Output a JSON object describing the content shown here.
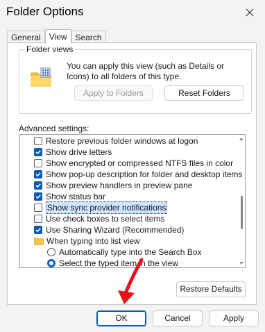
{
  "window": {
    "title": "Folder Options"
  },
  "tabs": [
    {
      "label": "General"
    },
    {
      "label": "View"
    },
    {
      "label": "Search"
    }
  ],
  "folder_views": {
    "title": "Folder views",
    "description": "You can apply this view (such as Details or Icons) to all folders of this type.",
    "apply_button": "Apply to Folders",
    "reset_button": "Reset Folders"
  },
  "advanced": {
    "label": "Advanced settings:",
    "items": [
      {
        "type": "checkbox",
        "checked": false,
        "label": "Restore previous folder windows at logon"
      },
      {
        "type": "checkbox",
        "checked": true,
        "label": "Show drive letters"
      },
      {
        "type": "checkbox",
        "checked": false,
        "label": "Show encrypted or compressed NTFS files in color"
      },
      {
        "type": "checkbox",
        "checked": true,
        "label": "Show pop-up description for folder and desktop items"
      },
      {
        "type": "checkbox",
        "checked": true,
        "label": "Show preview handlers in preview pane"
      },
      {
        "type": "checkbox",
        "checked": true,
        "label": "Show status bar"
      },
      {
        "type": "checkbox",
        "checked": false,
        "label": "Show sync provider notifications"
      },
      {
        "type": "checkbox",
        "checked": false,
        "label": "Use check boxes to select items"
      },
      {
        "type": "checkbox",
        "checked": true,
        "label": "Use Sharing Wizard (Recommended)"
      },
      {
        "type": "folder",
        "label": "When typing into list view"
      },
      {
        "type": "radio",
        "checked": false,
        "label": "Automatically type into the Search Box"
      },
      {
        "type": "radio",
        "checked": true,
        "label": "Select the typed item in the view"
      }
    ],
    "restore_defaults": "Restore Defaults"
  },
  "footer": {
    "ok": "OK",
    "cancel": "Cancel",
    "apply": "Apply"
  },
  "colors": {
    "accent": "#0f5bb4",
    "annotation_arrow": "#e8121b"
  },
  "icons": [
    "close-icon",
    "folder-views-icon",
    "folder-icon",
    "checkmark-icon",
    "annotation-arrow"
  ]
}
